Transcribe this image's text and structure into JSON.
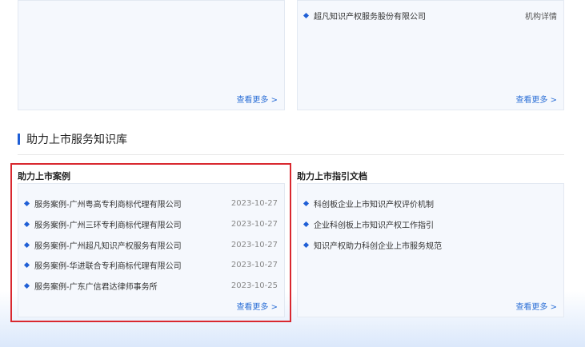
{
  "top_left_panel": {
    "more": "查看更多 >"
  },
  "top_right_panel": {
    "items": [
      {
        "text": "超凡知识产权服务股份有限公司",
        "action": "机构详情"
      }
    ],
    "more": "查看更多 >"
  },
  "section": {
    "title": "助力上市服务知识库"
  },
  "cases": {
    "title": "助力上市案例",
    "items": [
      {
        "text": "服务案例-广州粤高专利商标代理有限公司",
        "date": "2023-10-27"
      },
      {
        "text": "服务案例-广州三环专利商标代理有限公司",
        "date": "2023-10-27"
      },
      {
        "text": "服务案例-广州超凡知识产权服务有限公司",
        "date": "2023-10-27"
      },
      {
        "text": "服务案例-华进联合专利商标代理有限公司",
        "date": "2023-10-27"
      },
      {
        "text": "服务案例-广东广信君达律师事务所",
        "date": "2023-10-25"
      }
    ],
    "more": "查看更多 >"
  },
  "guides": {
    "title": "助力上市指引文档",
    "items": [
      {
        "text": "科创板企业上市知识产权评价机制"
      },
      {
        "text": "企业科创板上市知识产权工作指引"
      },
      {
        "text": "知识产权助力科创企业上市服务规范"
      }
    ],
    "more": "查看更多 >"
  },
  "colors": {
    "accent": "#1f5fd6",
    "highlight": "#d9282f"
  }
}
